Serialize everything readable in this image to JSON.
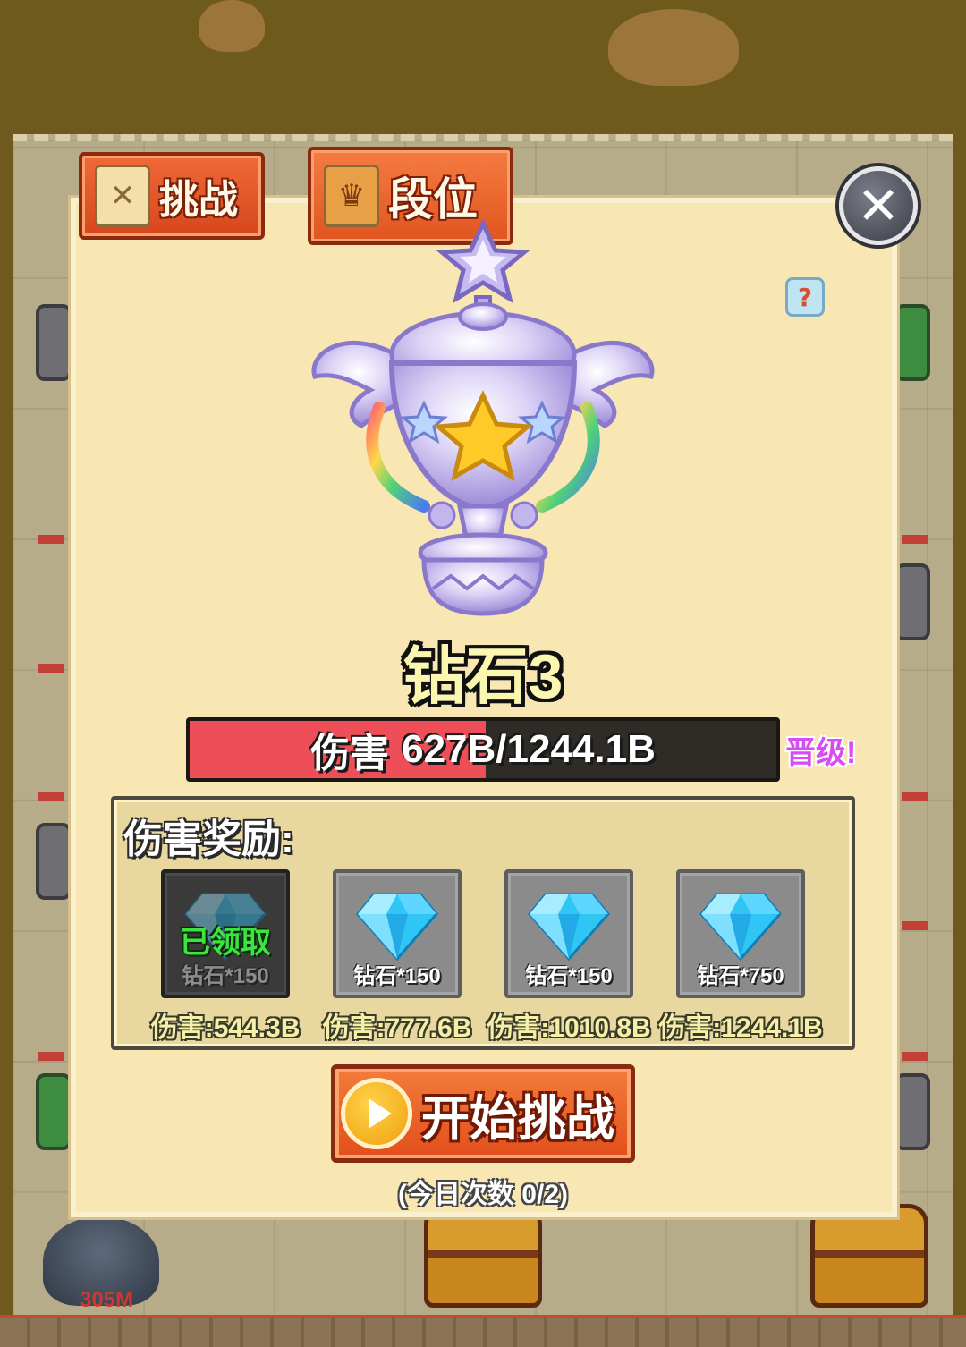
{
  "tabs": [
    {
      "label": "挑战",
      "icon": "scroll-map-icon",
      "active": false
    },
    {
      "label": "段位",
      "icon": "trophy-rank-icon",
      "active": true
    }
  ],
  "close_icon": "close-icon",
  "help_icon": "question-icon",
  "rank": {
    "title": "钻石3",
    "trophy_icon": "diamond-trophy-icon"
  },
  "progress": {
    "label": "伤害",
    "value_text": "627B/1244.1B",
    "current": 627,
    "max": 1244.1,
    "fill_color": "#ee4e57",
    "promote_text": "晋级!"
  },
  "rewards": {
    "title": "伤害奖励:",
    "items": [
      {
        "icon": "diamond-gem-icon",
        "amount": "钻石*150",
        "threshold": "伤害:544.3B",
        "claimed": true,
        "claimed_label": "已领取"
      },
      {
        "icon": "diamond-gem-icon",
        "amount": "钻石*150",
        "threshold": "伤害:777.6B",
        "claimed": false
      },
      {
        "icon": "diamond-gem-icon",
        "amount": "钻石*150",
        "threshold": "伤害:1010.8B",
        "claimed": false
      },
      {
        "icon": "diamond-gem-icon",
        "amount": "钻石*750",
        "threshold": "伤害:1244.1B",
        "claimed": false
      }
    ]
  },
  "start_button": {
    "label": "开始挑战",
    "icon": "play-icon"
  },
  "attempts_text": "(今日次数 0/2)",
  "background": {
    "unit_hp_label": "305M"
  }
}
